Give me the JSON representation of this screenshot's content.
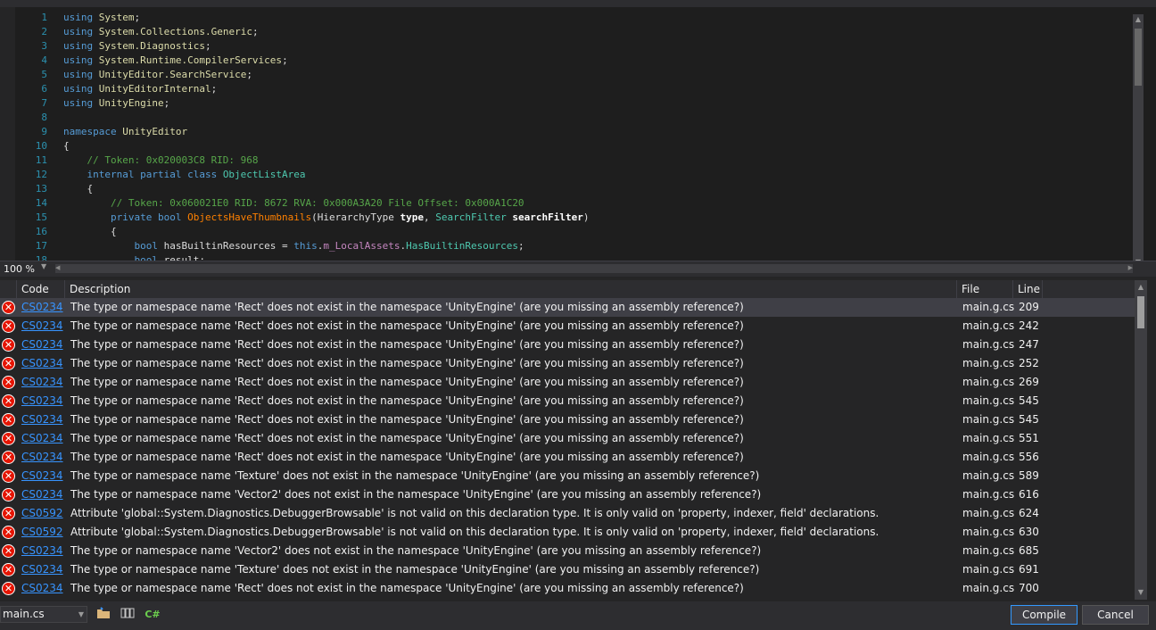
{
  "editor": {
    "lines": [
      {
        "n": "1",
        "t": [
          {
            "c": "kw",
            "s": "using "
          },
          {
            "c": "ns",
            "s": "System"
          },
          {
            "c": "plain",
            "s": ";"
          }
        ]
      },
      {
        "n": "2",
        "t": [
          {
            "c": "kw",
            "s": "using "
          },
          {
            "c": "ns",
            "s": "System.Collections.Generic"
          },
          {
            "c": "plain",
            "s": ";"
          }
        ]
      },
      {
        "n": "3",
        "t": [
          {
            "c": "kw",
            "s": "using "
          },
          {
            "c": "ns",
            "s": "System.Diagnostics"
          },
          {
            "c": "plain",
            "s": ";"
          }
        ]
      },
      {
        "n": "4",
        "t": [
          {
            "c": "kw",
            "s": "using "
          },
          {
            "c": "ns",
            "s": "System.Runtime.CompilerServices"
          },
          {
            "c": "plain",
            "s": ";"
          }
        ]
      },
      {
        "n": "5",
        "t": [
          {
            "c": "kw",
            "s": "using "
          },
          {
            "c": "ns",
            "s": "UnityEditor.SearchService"
          },
          {
            "c": "plain",
            "s": ";"
          }
        ]
      },
      {
        "n": "6",
        "t": [
          {
            "c": "kw",
            "s": "using "
          },
          {
            "c": "ns",
            "s": "UnityEditorInternal"
          },
          {
            "c": "plain",
            "s": ";"
          }
        ]
      },
      {
        "n": "7",
        "t": [
          {
            "c": "kw",
            "s": "using "
          },
          {
            "c": "ns",
            "s": "UnityEngine"
          },
          {
            "c": "plain",
            "s": ";"
          }
        ]
      },
      {
        "n": "8",
        "t": []
      },
      {
        "n": "9",
        "t": [
          {
            "c": "kw",
            "s": "namespace "
          },
          {
            "c": "ns",
            "s": "UnityEditor"
          }
        ]
      },
      {
        "n": "10",
        "t": [
          {
            "c": "plain",
            "s": "{"
          }
        ]
      },
      {
        "n": "11",
        "t": [
          {
            "c": "cmt",
            "s": "    // Token: 0x020003C8 RID: 968"
          }
        ]
      },
      {
        "n": "12",
        "t": [
          {
            "c": "kw",
            "s": "    internal partial class "
          },
          {
            "c": "type",
            "s": "ObjectListArea"
          }
        ]
      },
      {
        "n": "13",
        "t": [
          {
            "c": "plain",
            "s": "    {"
          }
        ]
      },
      {
        "n": "14",
        "t": [
          {
            "c": "cmt",
            "s": "        // Token: 0x060021E0 RID: 8672 RVA: 0x000A3A20 File Offset: 0x000A1C20"
          }
        ]
      },
      {
        "n": "15",
        "t": [
          {
            "c": "kw",
            "s": "        private bool "
          },
          {
            "c": "method",
            "s": "ObjectsHaveThumbnails"
          },
          {
            "c": "plain",
            "s": "(HierarchyType "
          },
          {
            "c": "param",
            "s": "type"
          },
          {
            "c": "plain",
            "s": ", "
          },
          {
            "c": "type",
            "s": "SearchFilter "
          },
          {
            "c": "param",
            "s": "searchFilter"
          },
          {
            "c": "plain",
            "s": ")"
          }
        ]
      },
      {
        "n": "16",
        "t": [
          {
            "c": "plain",
            "s": "        {"
          }
        ]
      },
      {
        "n": "17",
        "t": [
          {
            "c": "kw",
            "s": "            bool "
          },
          {
            "c": "plain",
            "s": "hasBuiltinResources = "
          },
          {
            "c": "kw",
            "s": "this"
          },
          {
            "c": "plain",
            "s": "."
          },
          {
            "c": "field",
            "s": "m_LocalAssets"
          },
          {
            "c": "plain",
            "s": "."
          },
          {
            "c": "type",
            "s": "HasBuiltinResources"
          },
          {
            "c": "plain",
            "s": ";"
          }
        ]
      },
      {
        "n": "18",
        "t": [
          {
            "c": "kw",
            "s": "            bool "
          },
          {
            "c": "plain",
            "s": "result;"
          }
        ]
      }
    ]
  },
  "zoom": {
    "value": "100 %"
  },
  "error_list": {
    "columns": {
      "code": "Code",
      "description": "Description",
      "file": "File",
      "line": "Line"
    },
    "rows": [
      {
        "code": "CS0234",
        "description": "The type or namespace name 'Rect' does not exist in the namespace 'UnityEngine' (are you missing an assembly reference?)",
        "file": "main.g.cs",
        "line": "209"
      },
      {
        "code": "CS0234",
        "description": "The type or namespace name 'Rect' does not exist in the namespace 'UnityEngine' (are you missing an assembly reference?)",
        "file": "main.g.cs",
        "line": "242"
      },
      {
        "code": "CS0234",
        "description": "The type or namespace name 'Rect' does not exist in the namespace 'UnityEngine' (are you missing an assembly reference?)",
        "file": "main.g.cs",
        "line": "247"
      },
      {
        "code": "CS0234",
        "description": "The type or namespace name 'Rect' does not exist in the namespace 'UnityEngine' (are you missing an assembly reference?)",
        "file": "main.g.cs",
        "line": "252"
      },
      {
        "code": "CS0234",
        "description": "The type or namespace name 'Rect' does not exist in the namespace 'UnityEngine' (are you missing an assembly reference?)",
        "file": "main.g.cs",
        "line": "269"
      },
      {
        "code": "CS0234",
        "description": "The type or namespace name 'Rect' does not exist in the namespace 'UnityEngine' (are you missing an assembly reference?)",
        "file": "main.g.cs",
        "line": "545"
      },
      {
        "code": "CS0234",
        "description": "The type or namespace name 'Rect' does not exist in the namespace 'UnityEngine' (are you missing an assembly reference?)",
        "file": "main.g.cs",
        "line": "545"
      },
      {
        "code": "CS0234",
        "description": "The type or namespace name 'Rect' does not exist in the namespace 'UnityEngine' (are you missing an assembly reference?)",
        "file": "main.g.cs",
        "line": "551"
      },
      {
        "code": "CS0234",
        "description": "The type or namespace name 'Rect' does not exist in the namespace 'UnityEngine' (are you missing an assembly reference?)",
        "file": "main.g.cs",
        "line": "556"
      },
      {
        "code": "CS0234",
        "description": "The type or namespace name 'Texture' does not exist in the namespace 'UnityEngine' (are you missing an assembly reference?)",
        "file": "main.g.cs",
        "line": "589"
      },
      {
        "code": "CS0234",
        "description": "The type or namespace name 'Vector2' does not exist in the namespace 'UnityEngine' (are you missing an assembly reference?)",
        "file": "main.g.cs",
        "line": "616"
      },
      {
        "code": "CS0592",
        "description": "Attribute 'global::System.Diagnostics.DebuggerBrowsable' is not valid on this declaration type. It is only valid on 'property, indexer, field' declarations.",
        "file": "main.g.cs",
        "line": "624"
      },
      {
        "code": "CS0592",
        "description": "Attribute 'global::System.Diagnostics.DebuggerBrowsable' is not valid on this declaration type. It is only valid on 'property, indexer, field' declarations.",
        "file": "main.g.cs",
        "line": "630"
      },
      {
        "code": "CS0234",
        "description": "The type or namespace name 'Vector2' does not exist in the namespace 'UnityEngine' (are you missing an assembly reference?)",
        "file": "main.g.cs",
        "line": "685"
      },
      {
        "code": "CS0234",
        "description": "The type or namespace name 'Texture' does not exist in the namespace 'UnityEngine' (are you missing an assembly reference?)",
        "file": "main.g.cs",
        "line": "691"
      },
      {
        "code": "CS0234",
        "description": "The type or namespace name 'Rect' does not exist in the namespace 'UnityEngine' (are you missing an assembly reference?)",
        "file": "main.g.cs",
        "line": "700"
      }
    ]
  },
  "bottom": {
    "file_name": "main.cs",
    "toolbar_icons": [
      "open-folder-icon",
      "references-icon",
      "csharp-icon"
    ],
    "csharp_label": "C#",
    "compile_label": "Compile",
    "cancel_label": "Cancel"
  },
  "colors": {
    "editor_bg": "#1e1e1e",
    "panel_bg": "#252526",
    "error_red": "#e51400",
    "link_blue": "#3794ff",
    "accent_blue": "#3399ff"
  }
}
